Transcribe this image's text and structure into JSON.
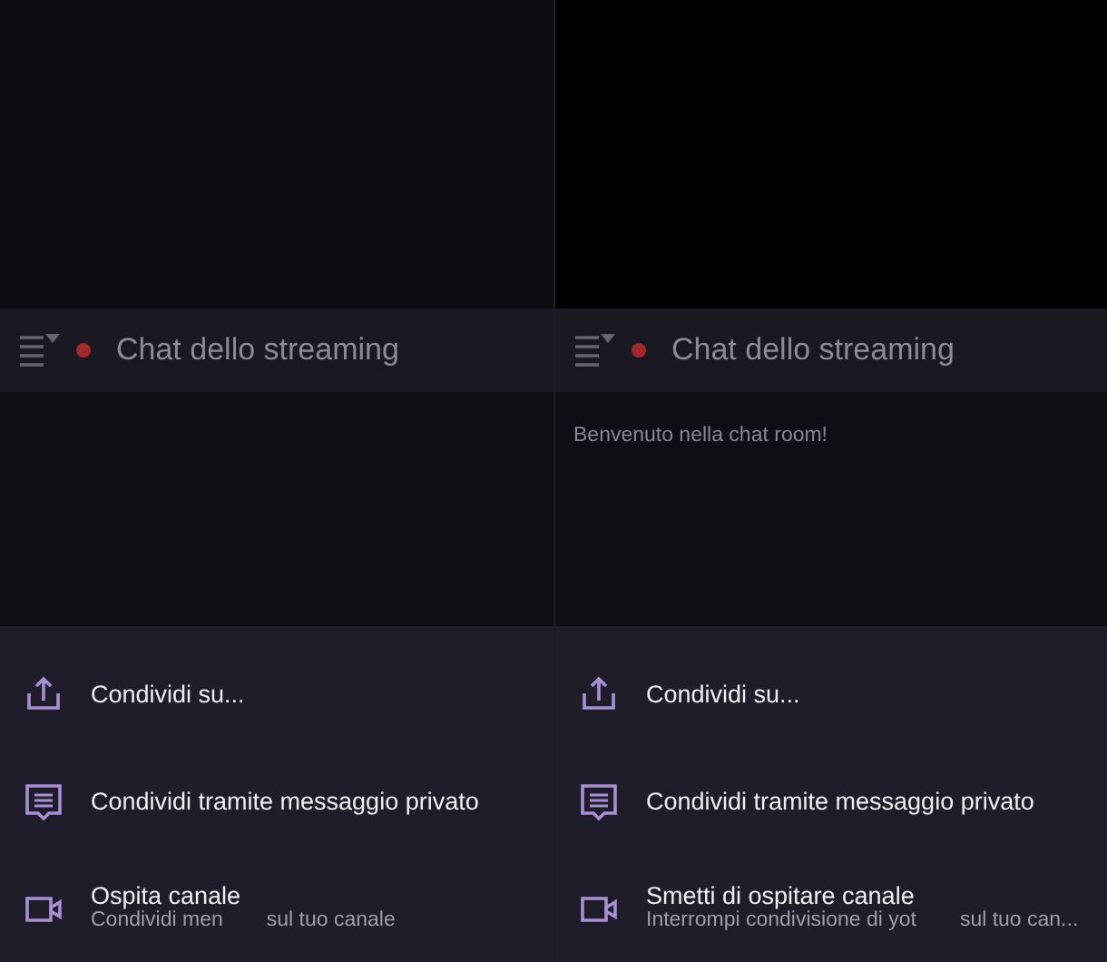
{
  "panels": [
    {
      "chat_title": "Chat dello streaming",
      "actions": [
        {
          "kind": "share",
          "label": "Condividi su..."
        },
        {
          "kind": "whisper",
          "label": "Condividi tramite messaggio privato"
        },
        {
          "kind": "host",
          "label": "Ospita canale",
          "subtitle_parts": [
            "Condividi men",
            "sul tuo canale"
          ]
        }
      ]
    },
    {
      "chat_title": "Chat dello streaming",
      "messages": [
        "Benvenuto nella chat room!"
      ],
      "actions": [
        {
          "kind": "share",
          "label": "Condividi su..."
        },
        {
          "kind": "whisper",
          "label": "Condividi tramite messaggio privato"
        },
        {
          "kind": "host",
          "label": "Smetti di ospitare canale",
          "subtitle_parts": [
            "Interrompi condivisione di yot",
            "sul tuo can..."
          ]
        }
      ]
    }
  ]
}
